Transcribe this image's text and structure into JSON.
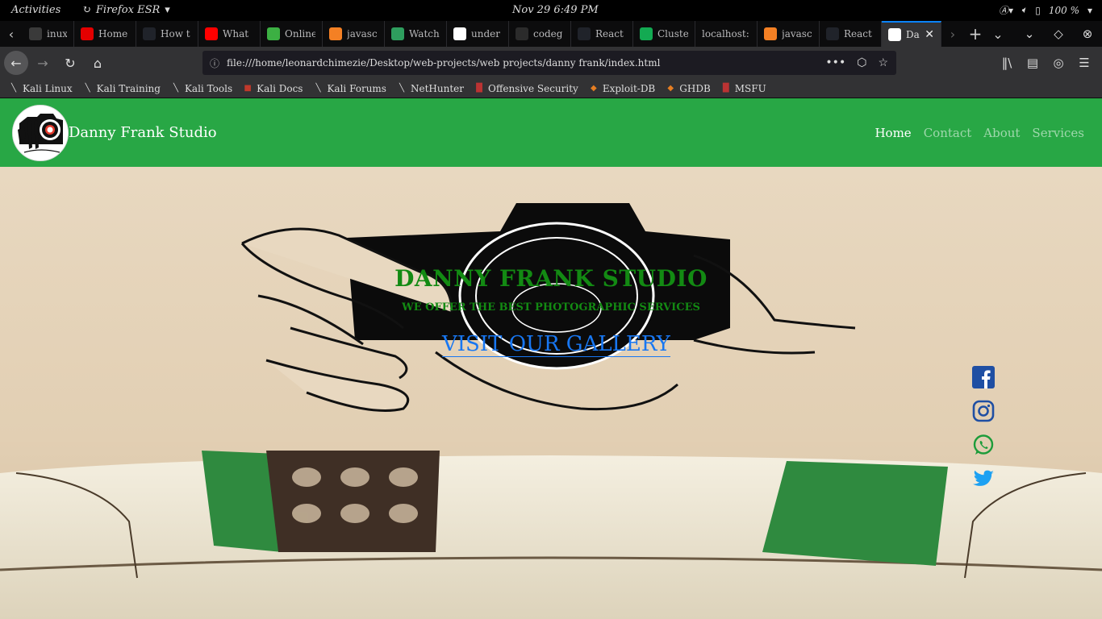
{
  "system": {
    "activities": "Activities",
    "app_name": "Firefox ESR",
    "clock": "Nov 29   6:49 PM",
    "battery": "100 %"
  },
  "tabs": [
    {
      "title": "inux",
      "icon": "kali-icon",
      "color": "#3a3a3a"
    },
    {
      "title": "Home",
      "icon": "airtel-icon",
      "color": "#e40000"
    },
    {
      "title": "How t",
      "icon": "react-icon",
      "color": "#20232a"
    },
    {
      "title": "What",
      "icon": "youtube-icon",
      "color": "#ff0000"
    },
    {
      "title": "Online",
      "icon": "download-icon",
      "color": "#3cb043"
    },
    {
      "title": "javasc",
      "icon": "stackoverflow-icon",
      "color": "#f48024"
    },
    {
      "title": "Watch",
      "icon": "watch-icon",
      "color": "#2e9e5e"
    },
    {
      "title": "under",
      "icon": "google-icon",
      "color": "#ffffff"
    },
    {
      "title": "codeg",
      "icon": "codegrepper-icon",
      "color": "#2b2b2b"
    },
    {
      "title": "React",
      "icon": "react-icon",
      "color": "#20232a"
    },
    {
      "title": "Cluste",
      "icon": "mongodb-icon",
      "color": "#13aa52"
    },
    {
      "title": "localhost:",
      "icon": "none",
      "color": "#0c0c0d"
    },
    {
      "title": "javasc",
      "icon": "stackoverflow-icon",
      "color": "#f48024"
    },
    {
      "title": "React",
      "icon": "react-icon",
      "color": "#20232a"
    },
    {
      "title": "Da",
      "icon": "camera-icon",
      "color": "#ffffff"
    }
  ],
  "navbar": {
    "url": "file:///home/leonardchimezie/Desktop/web-projects/web projects/danny frank/index.html"
  },
  "bookmarks": [
    {
      "label": "Kali Linux",
      "icon": "kali-dragon-icon"
    },
    {
      "label": "Kali Training",
      "icon": "kali-dragon-icon"
    },
    {
      "label": "Kali Tools",
      "icon": "kali-dragon-icon"
    },
    {
      "label": "Kali Docs",
      "icon": "kali-docs-icon"
    },
    {
      "label": "Kali Forums",
      "icon": "kali-dragon-icon"
    },
    {
      "label": "NetHunter",
      "icon": "kali-dragon-icon"
    },
    {
      "label": "Offensive Security",
      "icon": "offsec-icon"
    },
    {
      "label": "Exploit-DB",
      "icon": "exploitdb-icon"
    },
    {
      "label": "GHDB",
      "icon": "exploitdb-icon"
    },
    {
      "label": "MSFU",
      "icon": "offsec-icon"
    }
  ],
  "site": {
    "brand": "Danny Frank Studio",
    "menu": [
      "Home",
      "Contact",
      "About",
      "Services"
    ],
    "hero_title": "DANNY FRANK STUDIO",
    "hero_subtitle": "WE OFFER THE BEST PHOTOGRAPHIC SERVICES",
    "hero_cta": "VISIT OUR GALLERY",
    "social": [
      "facebook-icon",
      "instagram-icon",
      "whatsapp-icon",
      "twitter-icon"
    ],
    "colors": {
      "header": "#28a745",
      "title": "#138a13",
      "cta": "#1877f2"
    }
  }
}
